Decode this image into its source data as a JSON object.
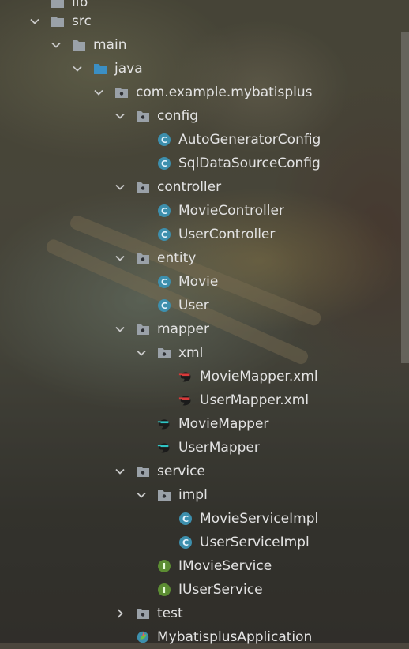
{
  "tree": [
    {
      "key": "lib",
      "label": "lib",
      "type": "folder",
      "expanded": false,
      "chevron": false
    },
    {
      "key": "src",
      "label": "src",
      "type": "folder",
      "expanded": true,
      "chevron": true
    },
    {
      "key": "main",
      "label": "main",
      "type": "folder",
      "expanded": true,
      "chevron": true
    },
    {
      "key": "java",
      "label": "java",
      "type": "source-folder",
      "expanded": true,
      "chevron": true
    },
    {
      "key": "package",
      "label": "com.example.mybatisplus",
      "type": "package",
      "expanded": true,
      "chevron": true
    },
    {
      "key": "config",
      "label": "config",
      "type": "package",
      "expanded": true,
      "chevron": true
    },
    {
      "key": "auto-generator-config",
      "label": "AutoGeneratorConfig",
      "type": "class"
    },
    {
      "key": "sql-data-source-config",
      "label": "SqlDataSourceConfig",
      "type": "class"
    },
    {
      "key": "controller",
      "label": "controller",
      "type": "package",
      "expanded": true,
      "chevron": true
    },
    {
      "key": "movie-controller",
      "label": "MovieController",
      "type": "class"
    },
    {
      "key": "user-controller",
      "label": "UserController",
      "type": "class"
    },
    {
      "key": "entity",
      "label": "entity",
      "type": "package",
      "expanded": true,
      "chevron": true
    },
    {
      "key": "movie",
      "label": "Movie",
      "type": "class"
    },
    {
      "key": "user",
      "label": "User",
      "type": "class"
    },
    {
      "key": "mapper",
      "label": "mapper",
      "type": "package",
      "expanded": true,
      "chevron": true
    },
    {
      "key": "xml",
      "label": "xml",
      "type": "package",
      "expanded": true,
      "chevron": true
    },
    {
      "key": "movie-mapper-xml",
      "label": "MovieMapper.xml",
      "type": "mybatis-xml"
    },
    {
      "key": "user-mapper-xml",
      "label": "UserMapper.xml",
      "type": "mybatis-xml"
    },
    {
      "key": "movie-mapper",
      "label": "MovieMapper",
      "type": "mapper"
    },
    {
      "key": "user-mapper",
      "label": "UserMapper",
      "type": "mapper"
    },
    {
      "key": "service",
      "label": "service",
      "type": "package",
      "expanded": true,
      "chevron": true
    },
    {
      "key": "impl",
      "label": "impl",
      "type": "package",
      "expanded": true,
      "chevron": true
    },
    {
      "key": "movie-service-impl",
      "label": "MovieServiceImpl",
      "type": "class"
    },
    {
      "key": "user-service-impl",
      "label": "UserServiceImpl",
      "type": "class"
    },
    {
      "key": "imovie-service",
      "label": "IMovieService",
      "type": "interface"
    },
    {
      "key": "iuser-service",
      "label": "IUserService",
      "type": "interface"
    },
    {
      "key": "test",
      "label": "test",
      "type": "package",
      "expanded": false,
      "chevron": true
    },
    {
      "key": "mybatisplus-application",
      "label": "MybatisplusApplication",
      "type": "spring-app"
    }
  ],
  "colors": {
    "folder": "#9aa1a8",
    "source_folder": "#3b8fc4",
    "class": "#3d8fad",
    "interface": "#5c8d33",
    "text": "#e3e3e3"
  }
}
